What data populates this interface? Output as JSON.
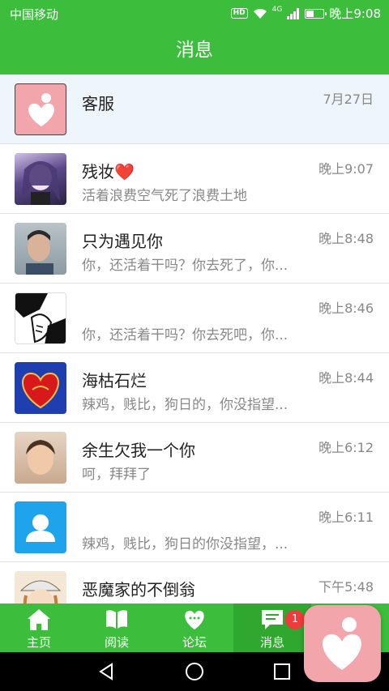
{
  "status": {
    "carrier": "中国移动",
    "hd": "HD",
    "net": "4G",
    "time": "晚上9:08"
  },
  "title": "消息",
  "messages": [
    {
      "name": "客服",
      "time": "7月27日",
      "msg": "",
      "avatar": "heart-logo-avatar"
    },
    {
      "name": "残妆❤️",
      "time": "晚上9:07",
      "msg": "活着浪费空气死了浪费土地",
      "avatar": "anime-girl-avatar"
    },
    {
      "name": "只为遇见你",
      "time": "晚上8:48",
      "msg": "你，还活着干吗？你去死了，你...",
      "avatar": "man-photo-avatar"
    },
    {
      "name": "",
      "time": "晚上8:46",
      "msg": "你，还活着干吗？你去死吧，你...",
      "avatar": "sketch-avatar"
    },
    {
      "name": "海枯石烂",
      "time": "晚上8:44",
      "msg": "辣鸡，贱比，狗日的，你没指望...",
      "avatar": "red-heart-avatar"
    },
    {
      "name": "余生欠我一个你",
      "time": "晚上6:12",
      "msg": "呵，拜拜了",
      "avatar": "boy-photo-avatar"
    },
    {
      "name": "",
      "time": "晚上6:11",
      "msg": "辣鸡，贱比，狗日的你没指望，...",
      "avatar": "default-user-avatar"
    },
    {
      "name": "恶魔家的不倒翁",
      "time": "下午5:48",
      "msg": "",
      "avatar": "anime-hat-avatar"
    }
  ],
  "tabs": [
    {
      "label": "主页",
      "icon": "home-icon"
    },
    {
      "label": "阅读",
      "icon": "book-icon"
    },
    {
      "label": "论坛",
      "icon": "heart-chat-icon"
    },
    {
      "label": "消息",
      "icon": "message-icon"
    }
  ],
  "badge": "1",
  "colors": {
    "primary": "#3cbe3c",
    "badge": "#ef3b3b",
    "logo": "#f2a6ab"
  }
}
